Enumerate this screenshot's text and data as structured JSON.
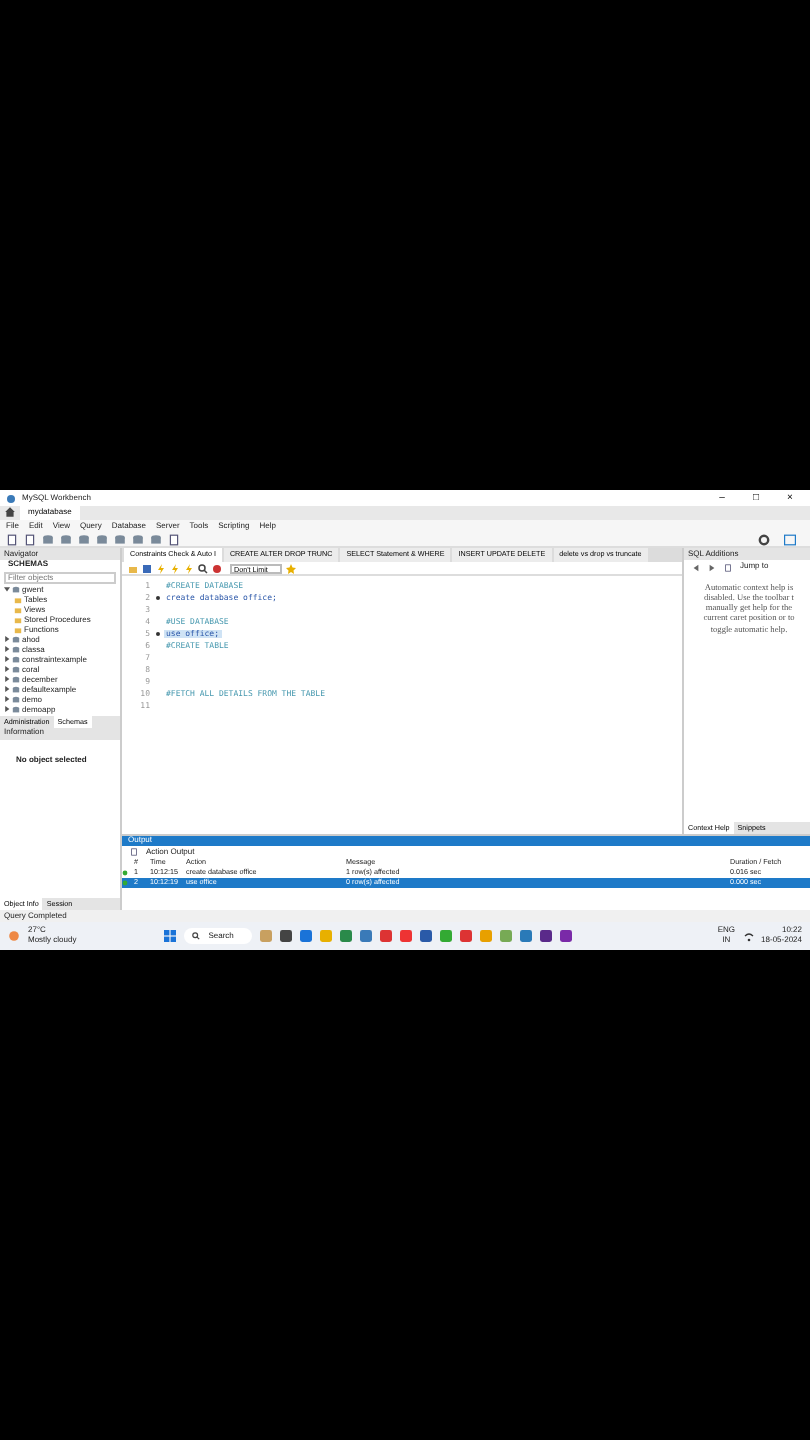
{
  "window": {
    "title": "MySQL Workbench",
    "controls": [
      "–",
      "□",
      "×"
    ]
  },
  "tabs": [
    {
      "label": "mydatabase",
      "selected": true
    }
  ],
  "menu": [
    "File",
    "Edit",
    "View",
    "Query",
    "Database",
    "Server",
    "Tools",
    "Scripting",
    "Help"
  ],
  "navigator": {
    "title": "Navigator",
    "section": "SCHEMAS",
    "filter_placeholder": "Filter objects",
    "tree": [
      {
        "label": "gwent",
        "expanded": true,
        "children": [
          {
            "label": "Tables"
          },
          {
            "label": "Views"
          },
          {
            "label": "Stored Procedures"
          },
          {
            "label": "Functions"
          }
        ]
      },
      {
        "label": "ahod",
        "expanded": false
      },
      {
        "label": "classa",
        "expanded": false
      },
      {
        "label": "constraintexample",
        "expanded": false
      },
      {
        "label": "coral",
        "expanded": false
      },
      {
        "label": "december",
        "expanded": false
      },
      {
        "label": "defaultexample",
        "expanded": false
      },
      {
        "label": "demo",
        "expanded": false
      },
      {
        "label": "demoapp",
        "expanded": false
      }
    ],
    "tabs": [
      {
        "label": "Administration",
        "selected": false
      },
      {
        "label": "Schemas",
        "selected": true
      }
    ],
    "info_title": "Information",
    "info_text": "No object selected",
    "bottom_tabs": [
      {
        "label": "Object Info",
        "selected": true
      },
      {
        "label": "Session",
        "selected": false
      }
    ]
  },
  "editor_tabs": [
    {
      "label": "Constraints Check & Auto I",
      "selected": true
    },
    {
      "label": "CREATE ALTER DROP TRUNC",
      "selected": false
    },
    {
      "label": "SELECT Statement & WHERE",
      "selected": false
    },
    {
      "label": "INSERT UPDATE DELETE",
      "selected": false
    },
    {
      "label": "delete vs drop vs truncate",
      "selected": false
    }
  ],
  "limit": "Don't Limit",
  "code": [
    {
      "number": "1",
      "text": "#CREATE DATABASE",
      "kind": "comment",
      "marker": false,
      "highlighted": false
    },
    {
      "number": "2",
      "text": "create database office;",
      "kind": "code",
      "marker": true,
      "highlighted": false
    },
    {
      "number": "3",
      "marker": false
    },
    {
      "number": "4",
      "text": "#USE DATABASE",
      "kind": "comment",
      "marker": false,
      "highlighted": false
    },
    {
      "number": "5",
      "text": "use office;",
      "kind": "code",
      "marker": true,
      "highlighted": true
    },
    {
      "number": "6",
      "text": "#CREATE TABLE",
      "kind": "comment",
      "marker": false,
      "highlighted": false
    },
    {
      "number": "7",
      "marker": false
    },
    {
      "number": "8",
      "marker": false
    },
    {
      "number": "9",
      "marker": false
    },
    {
      "number": "10",
      "text": "#FETCH ALL DETAILS FROM THE TABLE",
      "kind": "comment",
      "marker": false,
      "highlighted": false
    },
    {
      "number": "11",
      "marker": false
    }
  ],
  "sql_additions": {
    "title": "SQL Additions",
    "jump": "Jump to",
    "help": [
      "Automatic context help is",
      "disabled. Use the toolbar t",
      "manually get help for the",
      "current caret position or to",
      "toggle automatic help."
    ],
    "tabs": [
      {
        "label": "Context Help",
        "selected": true
      },
      {
        "label": "Snippets",
        "selected": false
      }
    ]
  },
  "output": {
    "title": "Output",
    "mode": "Action Output",
    "columns": [
      "#",
      "Time",
      "Action",
      "Message",
      "Duration / Fetch"
    ],
    "rows": [
      {
        "kind": "success",
        "number": "1",
        "time": "10:12:15",
        "action": "create database office",
        "message": "1 row(s) affected",
        "duration": "0.016 sec",
        "selected": false
      },
      {
        "kind": "success",
        "number": "2",
        "time": "10:12:19",
        "action": "use office",
        "message": "0 row(s) affected",
        "duration": "0.000 sec",
        "selected": true
      }
    ]
  },
  "status_bar": "Query Completed",
  "taskbar": {
    "weather": {
      "temp": "27°C",
      "text": "Mostly cloudy"
    },
    "search": "Search",
    "language": [
      "ENG",
      "IN"
    ],
    "time": "10:22",
    "date": "18-05-2024"
  }
}
